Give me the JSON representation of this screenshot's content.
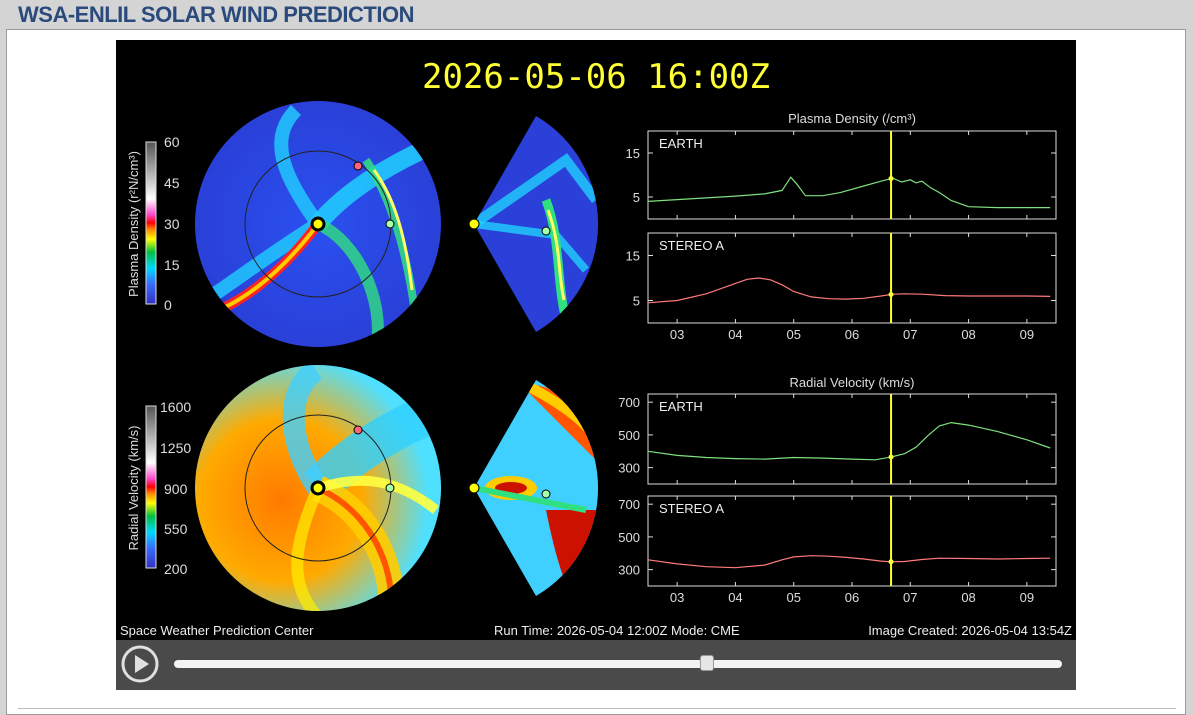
{
  "page": {
    "title": "WSA-ENLIL SOLAR WIND PREDICTION"
  },
  "viz": {
    "timestamp": "2026-05-06 16:00Z",
    "footer": {
      "left": "Space Weather Prediction Center",
      "run": "Run Time: 2026-05-04 12:00Z  Mode: CME",
      "created": "Image Created: 2026-05-04 13:54Z"
    },
    "density_colorbar": {
      "label": "Plasma Density (r²N/cm³)",
      "ticks": [
        "60",
        "45",
        "30",
        "15",
        "0"
      ]
    },
    "velocity_colorbar": {
      "label": "Radial Velocity (km/s)",
      "ticks": [
        "1600",
        "1250",
        "900",
        "550",
        "200"
      ]
    },
    "colors": {
      "earth_line": "#7ee07e",
      "stereo_line": "#ff7a7a",
      "time_marker": "#ffff33",
      "timestamp": "#ffff33"
    }
  },
  "controls": {
    "play_icon": "play-circle-icon",
    "slider_position": 0.6
  },
  "chart_data": [
    {
      "type": "line",
      "title": "Plasma Density (/cm³)",
      "panel_label": "EARTH",
      "categories": [
        "03",
        "04",
        "05",
        "06",
        "07",
        "08",
        "09"
      ],
      "x": [
        2.5,
        3.0,
        3.5,
        4.0,
        4.5,
        4.8,
        4.95,
        5.05,
        5.2,
        5.5,
        5.8,
        6.2,
        6.5,
        6.7,
        6.85,
        7.0,
        7.1,
        7.2,
        7.35,
        7.5,
        7.7,
        8.0,
        8.5,
        9.0,
        9.4
      ],
      "series": [
        {
          "values": [
            4,
            4.4,
            4.8,
            5.2,
            5.7,
            6.5,
            9.5,
            8,
            5.3,
            5.3,
            6,
            7.5,
            8.6,
            9.3,
            8.4,
            8.9,
            8.2,
            8.6,
            7.1,
            6,
            4.2,
            2.8,
            2.6,
            2.6,
            2.6
          ]
        }
      ],
      "yticks": [
        "5",
        "15"
      ],
      "ylim": [
        0,
        20
      ],
      "xlim": [
        2.5,
        9.5
      ],
      "marker_x": 6.67
    },
    {
      "type": "line",
      "panel_label": "STEREO A",
      "categories": [
        "03",
        "04",
        "05",
        "06",
        "07",
        "08",
        "09"
      ],
      "x": [
        2.5,
        3.0,
        3.5,
        4.0,
        4.2,
        4.4,
        4.6,
        4.8,
        5.0,
        5.3,
        5.6,
        5.9,
        6.2,
        6.5,
        6.7,
        6.9,
        7.2,
        7.6,
        8.0,
        8.5,
        9.0,
        9.4
      ],
      "series": [
        {
          "values": [
            4.5,
            5,
            6.5,
            8.8,
            9.7,
            10,
            9.6,
            8.5,
            7,
            5.8,
            5.4,
            5.3,
            5.5,
            6,
            6.4,
            6.5,
            6.4,
            6.1,
            6,
            6,
            6,
            5.9
          ]
        }
      ],
      "yticks": [
        "5",
        "15"
      ],
      "ylim": [
        0,
        20
      ],
      "xlim": [
        2.5,
        9.5
      ],
      "marker_x": 6.67
    },
    {
      "type": "line",
      "title": "Radial Velocity (km/s)",
      "panel_label": "EARTH",
      "categories": [
        "03",
        "04",
        "05",
        "06",
        "07",
        "08",
        "09"
      ],
      "x": [
        2.5,
        3.0,
        3.5,
        4.0,
        4.5,
        5.0,
        5.5,
        6.0,
        6.4,
        6.67,
        6.9,
        7.1,
        7.3,
        7.5,
        7.7,
        8.0,
        8.5,
        9.0,
        9.4
      ],
      "series": [
        {
          "values": [
            400,
            375,
            362,
            355,
            352,
            362,
            358,
            352,
            348,
            365,
            385,
            425,
            495,
            555,
            575,
            560,
            520,
            470,
            420
          ]
        }
      ],
      "yticks": [
        "300",
        "500",
        "700"
      ],
      "ylim": [
        200,
        750
      ],
      "xlim": [
        2.5,
        9.5
      ],
      "marker_x": 6.67
    },
    {
      "type": "line",
      "panel_label": "STEREO A",
      "categories": [
        "03",
        "04",
        "05",
        "06",
        "07",
        "08",
        "09"
      ],
      "x": [
        2.5,
        3.0,
        3.5,
        4.0,
        4.5,
        4.8,
        5.0,
        5.3,
        5.6,
        5.9,
        6.2,
        6.5,
        6.67,
        6.9,
        7.2,
        7.5,
        8.0,
        8.5,
        9.0,
        9.4
      ],
      "series": [
        {
          "values": [
            360,
            335,
            318,
            312,
            328,
            360,
            378,
            385,
            382,
            375,
            365,
            352,
            348,
            350,
            362,
            370,
            368,
            365,
            368,
            370
          ]
        }
      ],
      "yticks": [
        "300",
        "500",
        "700"
      ],
      "ylim": [
        200,
        750
      ],
      "xlim": [
        2.5,
        9.5
      ],
      "marker_x": 6.67
    }
  ]
}
